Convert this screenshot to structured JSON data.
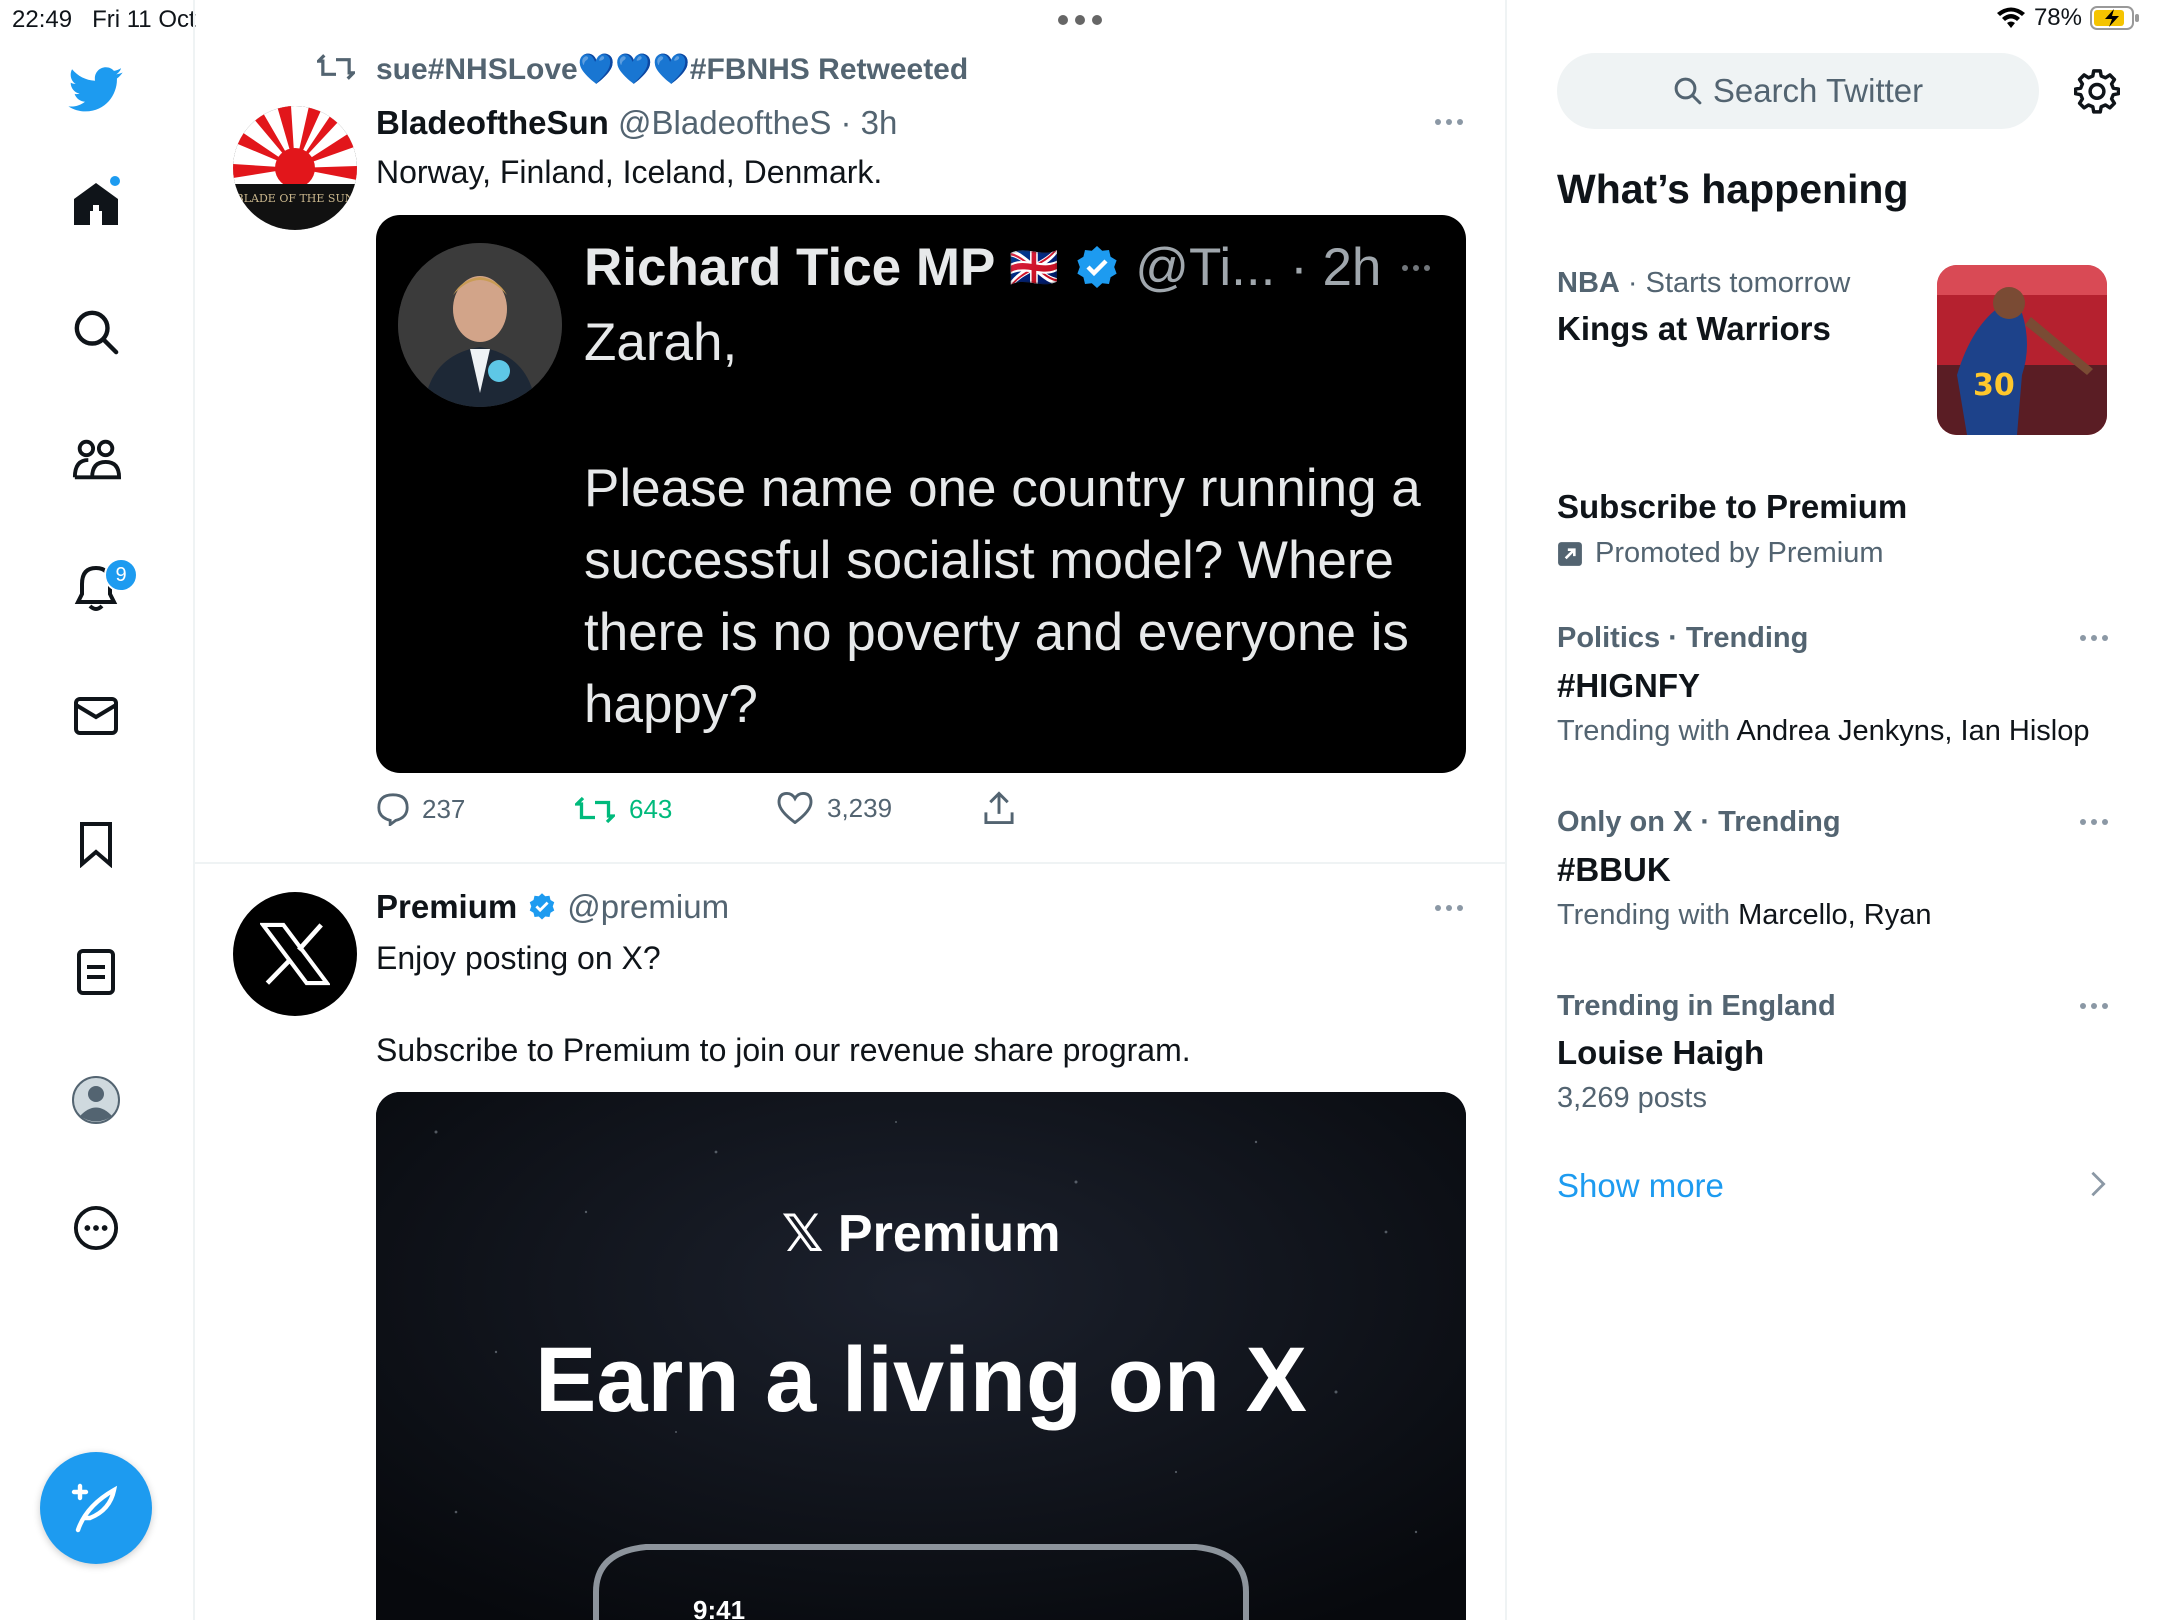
{
  "status_bar": {
    "time": "22:49",
    "date": "Fri 11 Oct",
    "battery": "78%"
  },
  "nav": {
    "notifications_count": "9",
    "items": [
      "home-icon",
      "search-icon",
      "communities-icon",
      "notifications-icon",
      "messages-icon",
      "bookmarks-icon",
      "lists-icon",
      "profile-icon",
      "more-icon"
    ]
  },
  "colors": {
    "accent": "#1d9bf0",
    "retweet_green": "#00ba7c",
    "muted": "#536471"
  },
  "tweet1": {
    "retweeted_by": "sue#NHSLove💙💙💙#FBNHS Retweeted",
    "author_name": "BladeoftheSun",
    "handle_time": "@BladeoftheS · 3h",
    "text": "Norway, Finland, Iceland, Denmark.",
    "avatar_text": "BLADE OF THE SUN",
    "quoted": {
      "name": "Richard Tice MP",
      "flag": "🇬🇧",
      "handle_time": "@Ti... · 2h",
      "text_line1": "Zarah,",
      "text_body": "Please name one country running a successful socialist model? Where there is no poverty and everyone is happy?"
    },
    "replies": "237",
    "retweets": "643",
    "likes": "3,239"
  },
  "tweet2": {
    "author_name": "Premium",
    "handle": "@premium",
    "text_line1": "Enjoy posting on X?",
    "text_line2": "Subscribe to Premium to join our revenue share program.",
    "media_logo": "𝕏 Premium",
    "media_headline": "Earn a living on X",
    "media_phone_time": "9:41"
  },
  "sidebar": {
    "search_placeholder": "Search Twitter",
    "section_title": "What’s happening",
    "trends": [
      {
        "meta_category": "NBA",
        "meta_rest": " · Starts tomorrow",
        "title": "Kings at Warriors"
      },
      {
        "title": "Subscribe to Premium",
        "promoted": "Promoted by Premium"
      },
      {
        "meta": "Politics · Trending",
        "title": "#HIGNFY",
        "sub_prefix": "Trending with ",
        "sub_names": "Andrea Jenkyns, Ian Hislop"
      },
      {
        "meta": "Only on X · Trending",
        "title": "#BBUK",
        "sub_prefix": "Trending with ",
        "sub_names": "Marcello, Ryan"
      },
      {
        "meta": "Trending in England",
        "title": "Louise Haigh",
        "sub": "3,269 posts"
      }
    ],
    "show_more": "Show more"
  }
}
